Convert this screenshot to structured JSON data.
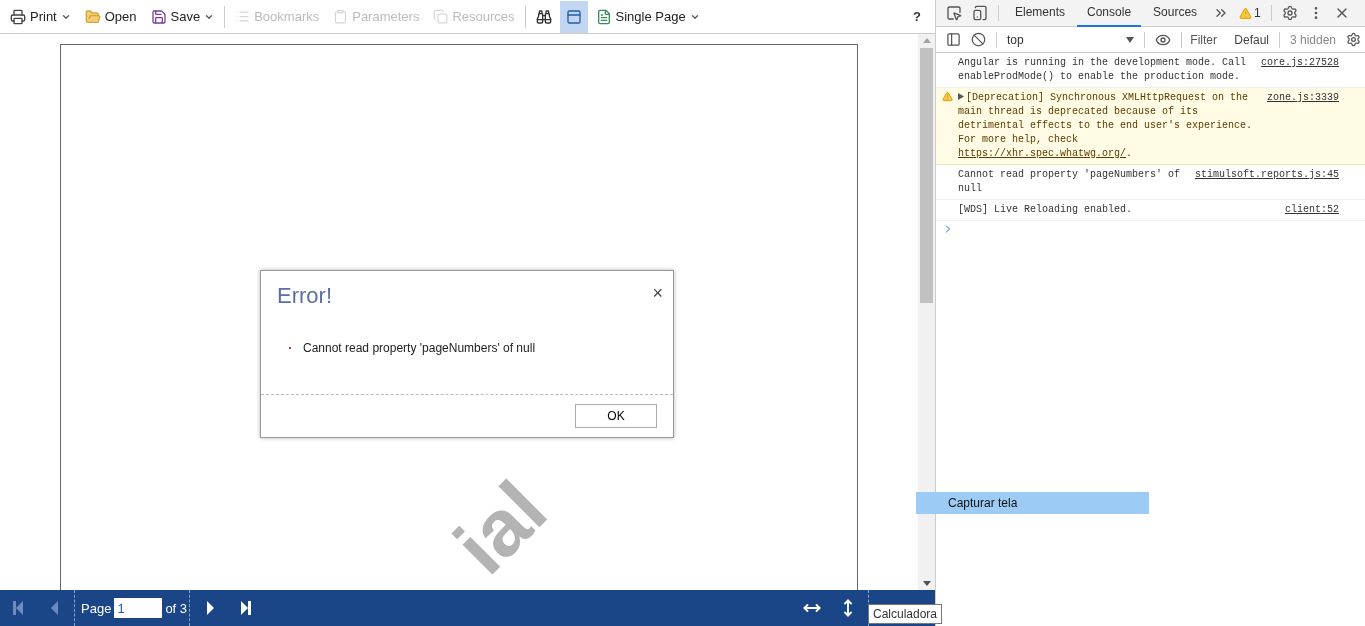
{
  "viewer": {
    "toolbar": {
      "groups": [
        [
          {
            "label": "Print",
            "dropdown": true,
            "disabled": false,
            "selected": false
          },
          {
            "label": "Open",
            "dropdown": false,
            "disabled": false,
            "selected": false
          },
          {
            "label": "Save",
            "dropdown": true,
            "disabled": false,
            "selected": false
          }
        ],
        [
          {
            "label": "Bookmarks",
            "dropdown": false,
            "disabled": true,
            "selected": false
          },
          {
            "label": "Parameters",
            "dropdown": false,
            "disabled": true,
            "selected": false
          },
          {
            "label": "Resources",
            "dropdown": false,
            "disabled": true,
            "selected": false
          }
        ],
        [
          {
            "dropdown": false,
            "disabled": false,
            "selected": false
          },
          {
            "dropdown": false,
            "disabled": false,
            "selected": true
          }
        ],
        [
          {
            "label": "Single Page",
            "dropdown": true,
            "disabled": false,
            "selected": false
          }
        ]
      ],
      "help": "?"
    },
    "report_page": {
      "watermark": "ial"
    },
    "dialog": {
      "title": "Error!",
      "close": "×",
      "message": "Cannot read property 'pageNumbers' of null",
      "button": "OK"
    },
    "pager": {
      "first_disabled": true,
      "prev_disabled": true,
      "label": "Page",
      "value": "1",
      "total": "of 3"
    },
    "tooltip": "Calculadora"
  },
  "devtools": {
    "tabs": [
      {
        "label": "Elements",
        "selected": false
      },
      {
        "label": "Console",
        "selected": true
      },
      {
        "label": "Sources",
        "selected": false
      }
    ],
    "warning_count": "1",
    "console_toolbar": {
      "context": "top",
      "filter_placeholder": "Filter",
      "levels": "Defaul",
      "hidden": "3 hidden"
    },
    "messages": [
      {
        "kind": "log",
        "text": "Angular is running in the development mode. Call enableProdMode() to enable the production mode.",
        "source": "core.js:27528"
      },
      {
        "kind": "warning",
        "text": "[Deprecation] Synchronous XMLHttpRequest on the main thread is deprecated because of its detrimental effects to the end user's experience. For more help, check ",
        "link": "https://xhr.spec.whatwg.org/",
        "after": ".",
        "source": "zone.js:3339"
      },
      {
        "kind": "log",
        "text": "Cannot read property 'pageNumbers' of null",
        "source": "stimulsoft.reports.js:45"
      },
      {
        "kind": "log",
        "text": "[WDS] Live Reloading enabled.",
        "source": "client:52"
      }
    ]
  },
  "overlay_bar": "Capturar tela"
}
